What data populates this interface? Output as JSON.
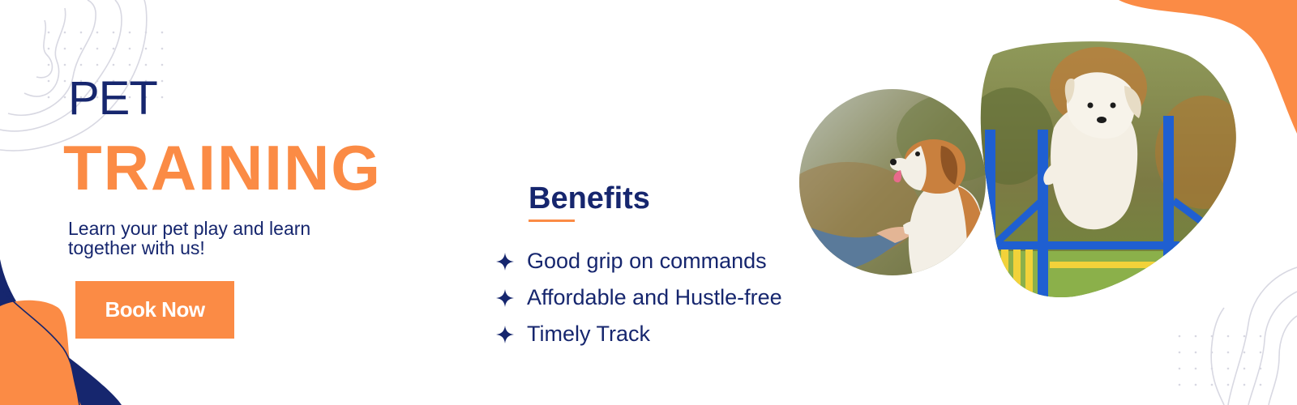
{
  "hero": {
    "pet": "PET",
    "training": "TRAINING",
    "tagline": "Learn your pet play and learn together with us!",
    "cta_label": "Book Now"
  },
  "benefits": {
    "title": "Benefits",
    "items": [
      {
        "label": "Good grip on commands",
        "icon": "sparkle-star-icon"
      },
      {
        "label": "Affordable and Hustle-free",
        "icon": "sparkle-star-icon"
      },
      {
        "label": "Timely Track",
        "icon": "sparkle-star-icon"
      }
    ]
  },
  "photos": [
    {
      "subject": "beagle giving paw to trainer",
      "shape": "circle"
    },
    {
      "subject": "golden retriever jumping agility hurdle",
      "shape": "blob"
    }
  ],
  "colors": {
    "navy": "#16266e",
    "orange": "#fb8b45",
    "background": "#ffffff",
    "line_gray": "#d8d8e2"
  }
}
